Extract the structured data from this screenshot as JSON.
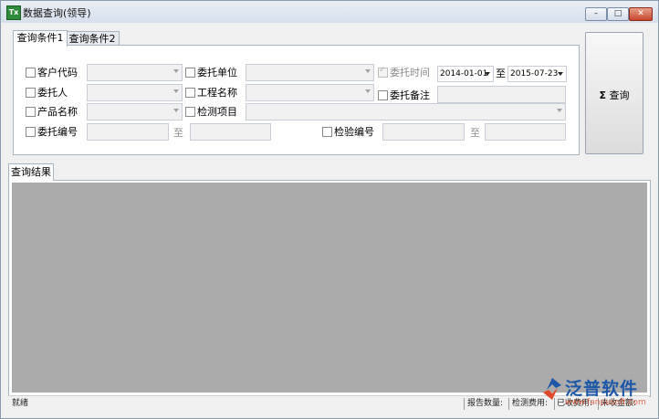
{
  "window": {
    "title": "数据查询(领导)",
    "app_icon": "Tx",
    "controls": {
      "minimize": "–",
      "maximize": "□",
      "close": "✕"
    }
  },
  "criteria_tabs": [
    {
      "label": "查询条件1",
      "active": true
    },
    {
      "label": "查询条件2",
      "active": false
    }
  ],
  "criteria": {
    "customer_code": {
      "label": "客户代码",
      "checked": false,
      "value": ""
    },
    "client_unit": {
      "label": "委托单位",
      "checked": false,
      "value": ""
    },
    "consign_time": {
      "label": "委托时间",
      "checked": true,
      "disabled": true,
      "from": "2014-01-01",
      "to_label": "至",
      "to": "2015-07-23"
    },
    "client_person": {
      "label": "委托人",
      "checked": false,
      "value": ""
    },
    "project_name": {
      "label": "工程名称",
      "checked": false,
      "value": ""
    },
    "consign_remark": {
      "label": "委托备注",
      "checked": false,
      "value": ""
    },
    "product_name": {
      "label": "产品名称",
      "checked": false,
      "value": ""
    },
    "test_item": {
      "label": "检测项目",
      "checked": false,
      "value": ""
    },
    "consign_no": {
      "label": "委托编号",
      "checked": false,
      "from": "",
      "to_label": "至",
      "to": ""
    },
    "inspect_no": {
      "label": "检验编号",
      "checked": false,
      "from": "",
      "to_label": "至",
      "to": ""
    }
  },
  "query_button": {
    "icon": "Σ",
    "label": "查询"
  },
  "results": {
    "tab_label": "查询结果"
  },
  "statusbar": {
    "status": "就绪",
    "report_count": "报告数量:",
    "test_fee": "检测费用:",
    "received_fee": "已收费用:",
    "unpaid_amount": "未收金额:"
  },
  "watermark": {
    "brand": "泛普软件",
    "url": "www.fanpusoft.com"
  }
}
